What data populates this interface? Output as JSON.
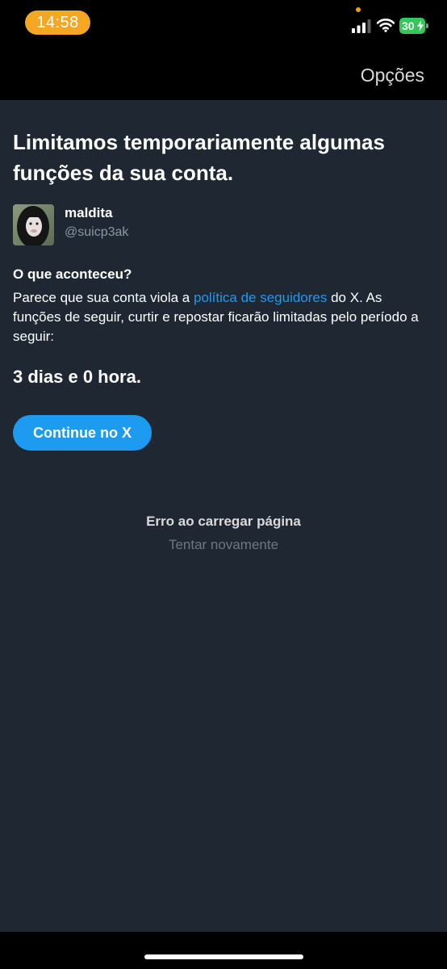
{
  "status_bar": {
    "time": "14:58",
    "battery_level": "30",
    "time_pill_color": "#f5a623",
    "battery_color": "#34c759",
    "icons": [
      "signal-icon",
      "wifi-icon",
      "battery-icon",
      "charging-bolt-icon"
    ]
  },
  "nav": {
    "options_label": "Opções"
  },
  "main": {
    "title": "Limitamos temporariamente algumas funções da sua conta.",
    "account": {
      "display_name": "maldita",
      "username": "@suicp3ak"
    },
    "section_heading": "O que aconteceu?",
    "explanation_before_link": "Parece que sua conta viola a ",
    "policy_link_label": "política de seguidores",
    "explanation_after_link": " do X. As funções de seguir, curtir e repostar ficarão limitadas pelo período a seguir:",
    "duration": "3 dias e 0 hora.",
    "continue_label": "Continue no X",
    "error_message": "Erro ao carregar página",
    "retry_label": "Tentar novamente"
  },
  "colors": {
    "background": "#1e2732",
    "accent": "#1d9bf0",
    "secondary_text": "#8899a6"
  }
}
